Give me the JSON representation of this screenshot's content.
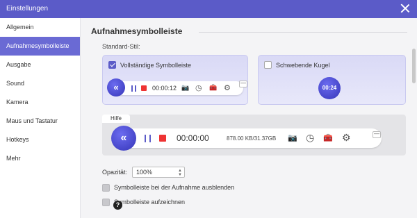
{
  "window": {
    "title": "Einstellungen"
  },
  "sidebar": {
    "items": [
      {
        "label": "Allgemein"
      },
      {
        "label": "Aufnahmesymbolleiste",
        "active": true
      },
      {
        "label": "Ausgabe"
      },
      {
        "label": "Sound"
      },
      {
        "label": "Kamera"
      },
      {
        "label": "Maus und Tastatur"
      },
      {
        "label": "Hotkeys"
      },
      {
        "label": "Mehr"
      }
    ]
  },
  "main": {
    "heading": "Aufnahmesymbolleiste",
    "standard_style_label": "Standard-Stil:",
    "style_options": {
      "full": {
        "label": "Vollständige Symbolleiste",
        "checked": true,
        "timer": "00:00:12"
      },
      "ball": {
        "label": "Schwebende Kugel",
        "checked": false,
        "timer": "00:24"
      }
    },
    "preview": {
      "tab_label": "Hilfe",
      "timer": "00:00:00",
      "file_size": "878.00 KB/31.37GB"
    },
    "opacity": {
      "label": "Opazität:",
      "value": "100%"
    },
    "options": [
      {
        "label": "Symbolleiste bei der Aufnahme ausblenden",
        "checked": false
      },
      {
        "label": "Symbolleiste aufzeichnen",
        "checked": false
      }
    ],
    "icons": {
      "collapse": "«",
      "camera": "📷",
      "clock": "◷",
      "toolbox": "🧰",
      "gear": "⚙",
      "minimize": "—",
      "help": "?"
    }
  },
  "colors": {
    "accent": "#5b5bc8",
    "record_stop": "#e33333",
    "card_bg": "#dcdcf7"
  }
}
